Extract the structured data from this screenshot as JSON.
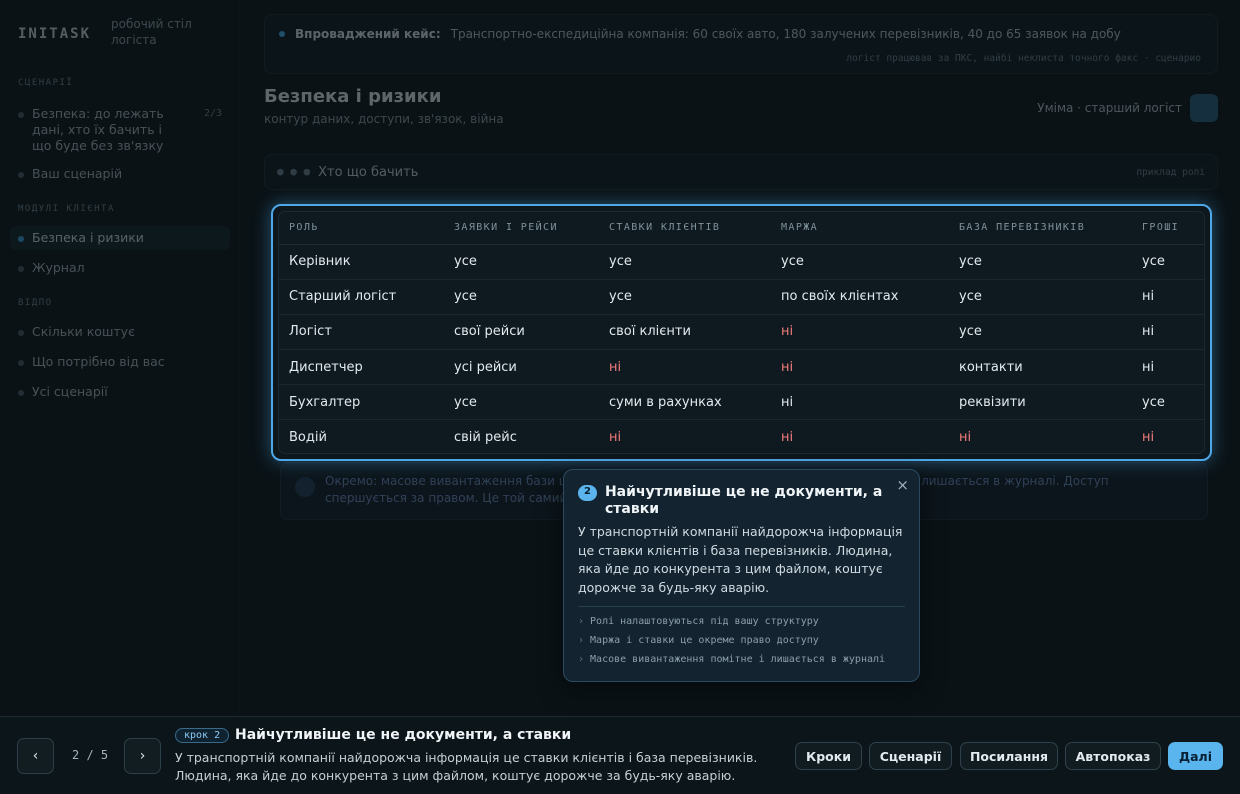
{
  "app": {
    "logo": "INITASK",
    "logo_sub": "робочий стіл логіста"
  },
  "sidebar": {
    "sections": [
      {
        "title": "СЦЕНАРІЇ",
        "items": [
          {
            "label": "Безпека: до лежать дані, хто їх бачить і що буде без зв'язку",
            "count": "2/3"
          },
          {
            "label": "Ваш сценарій"
          }
        ]
      },
      {
        "title": "МОДУЛІ КЛІЄНТА",
        "items": [
          {
            "label": "Безпека і ризики"
          },
          {
            "label": "Журнал"
          }
        ]
      },
      {
        "title": "ВІДПО",
        "items": [
          {
            "label": "Скільки коштує"
          },
          {
            "label": "Що потрібно від вас"
          },
          {
            "label": "Усі сценарії"
          }
        ]
      }
    ]
  },
  "banner": {
    "label": "Впроваджений кейс:",
    "text": "Транспортно-експедиційна компанія: 60 своїх авто, 180 залучених перевізників, 40 до 65 заявок на добу",
    "meta": "логіст працював за ПКС, найбі неклиста точного факс · сценарио"
  },
  "page": {
    "title": "Безпека і ризики",
    "subtitle": "контур даних, доступи, зв'язок, війна",
    "role_label": "Уміма · старший логіст"
  },
  "subhead": {
    "dots": "● ● ●",
    "title": "Хто що бачить",
    "right": "приклад ролі"
  },
  "table": {
    "headers": [
      "РОЛЬ",
      "ЗАЯВКИ І РЕЙСИ",
      "СТАВКИ КЛІЄНТІВ",
      "МАРЖА",
      "БАЗА ПЕРЕВІЗНИКІВ",
      "ГРОШІ"
    ],
    "rows": [
      [
        "Керівник",
        "усе",
        "усе",
        "усе",
        "усе",
        "усе"
      ],
      [
        "Старший логіст",
        "усе",
        "усе",
        "по своїх клієнтах",
        "усе",
        "ні"
      ],
      [
        "Логіст",
        "свої рейси",
        "свої клієнти",
        "ні",
        "усе",
        "ні"
      ],
      [
        "Диспетчер",
        "усі рейси",
        "ні",
        "ні",
        "контакти",
        "ні"
      ],
      [
        "Бухгалтер",
        "усе",
        "суми в рахунках",
        "ні",
        "реквізити",
        "усе"
      ],
      [
        "Водій",
        "свій рейс",
        "ні",
        "ні",
        "ні",
        "ні"
      ]
    ],
    "red_cells": [
      [
        2,
        3
      ],
      [
        3,
        2
      ],
      [
        3,
        3
      ],
      [
        5,
        2
      ],
      [
        5,
        3
      ],
      [
        5,
        4
      ],
      [
        5,
        5
      ]
    ]
  },
  "note": {
    "text": "Окремо: масове вивантаження бази це не помилка, а ознака витоку. Помітне для керівника, лишається в журналі. Доступ спершується за правом. Це той самий випадок, коли логіст іде разом зі ставками"
  },
  "popover": {
    "step": "2",
    "title": "Найчутливіше це не документи, а ставки",
    "body": "У транспортній компанії найдорожча інформація це ставки клієнтів і база перевізників. Людина, яка йде до конкурента з цим файлом, коштує дорожче за будь-яку аварію.",
    "bullets": [
      "Ролі налаштовуються під вашу структуру",
      "Маржа і ставки це окреме право доступу",
      "Масове вивантаження помітне і лишається в журналі"
    ],
    "close": "×",
    "arrow": "›"
  },
  "bottom": {
    "prev": "‹",
    "next": "›",
    "pager": "2 / 5",
    "step_tag": "крок 2",
    "title": "Найчутливіше це не документи, а ставки",
    "desc": "У транспортній компанії найдорожча інформація це ставки клієнтів і база перевізників. Людина, яка йде до конкурента з цим файлом, коштує дорожче за будь-яку аварію.",
    "buttons": {
      "steps": "Кроки",
      "scenarios": "Сценарії",
      "links": "Посилання",
      "autoplay": "Автопоказ",
      "next": "Далі"
    }
  },
  "colors": {
    "accent": "#5ab4ee",
    "negative": "#f27b7b",
    "background": "#0a1216"
  }
}
